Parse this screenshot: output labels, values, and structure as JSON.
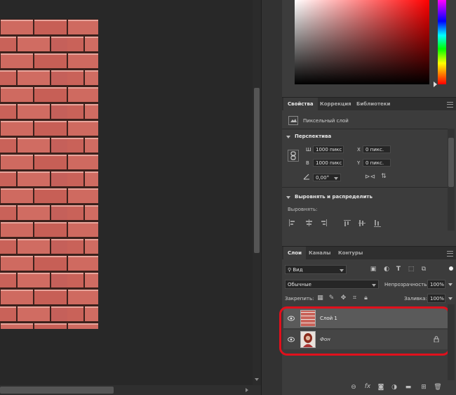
{
  "properties_panel": {
    "tabs": [
      "Свойства",
      "Коррекция",
      "Библиотеки"
    ],
    "active_tab": "Свойства",
    "layer_kind": "Пиксельный слой",
    "perspective": {
      "title": "Перспектива",
      "w_label": "Ш",
      "w_value": "1000 пикс",
      "h_label": "В",
      "h_value": "1000 пикс",
      "x_label": "X",
      "x_value": "0 пикс.",
      "y_label": "Y",
      "y_value": "0 пикс.",
      "angle_value": "0,00°"
    },
    "align": {
      "title": "Выровнять и распределить",
      "subtitle": "Выровнять:"
    }
  },
  "layers_panel": {
    "tabs": [
      "Слои",
      "Каналы",
      "Контуры"
    ],
    "active_tab": "Слои",
    "filter_label": "Вид",
    "blend_mode": "Обычные",
    "opacity_label": "Непрозрачность:",
    "opacity_value": "100%",
    "lock_label": "Закрепить:",
    "fill_label": "Заливка:",
    "fill_value": "100%",
    "layers": [
      {
        "name": "Слой 1",
        "selected": true,
        "locked": false
      },
      {
        "name": "Фон",
        "selected": false,
        "locked": true
      }
    ]
  },
  "colors": {
    "highlight": "#e0101c",
    "selected_row": "#5a5a5a",
    "panel_bg": "#3c3c3c",
    "brick": "#c9635a"
  }
}
